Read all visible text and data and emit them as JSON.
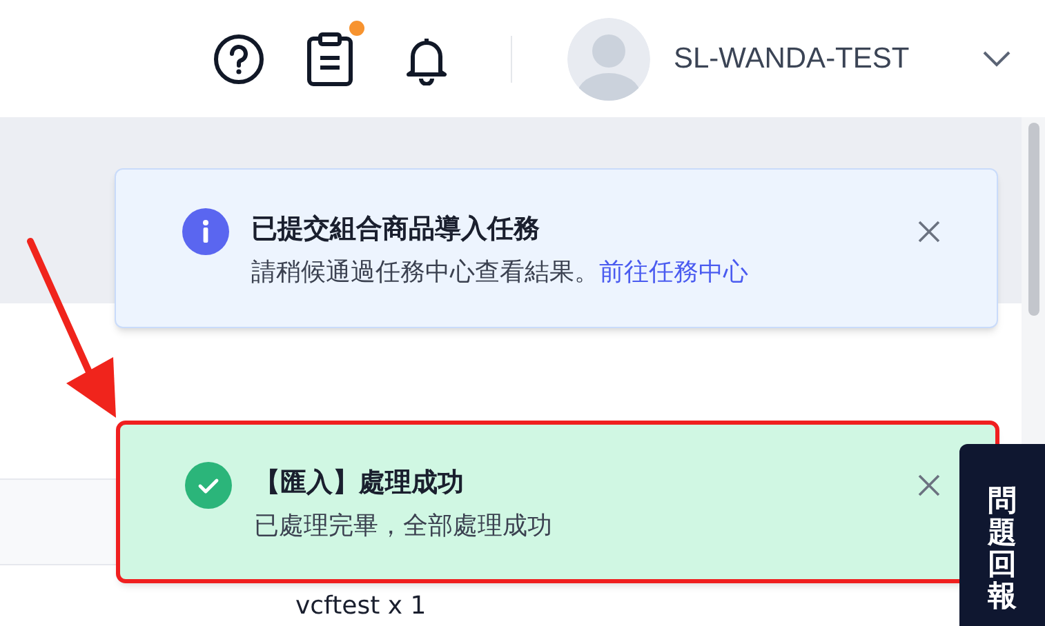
{
  "header": {
    "task_badge": true,
    "user_name": "SL-WANDA-TEST"
  },
  "toasts": [
    {
      "kind": "info",
      "title": "已提交組合商品導入任務",
      "message": "請稍候通過任務中心查看結果。",
      "link": "前往任務中心",
      "highlighted": false
    },
    {
      "kind": "success",
      "title": "【匯入】處理成功",
      "message": "已處理完畢，全部處理成功",
      "highlighted": true
    }
  ],
  "background": {
    "row_text": "vcftest x 1"
  },
  "feedback_tab": {
    "label": "問題回報"
  }
}
